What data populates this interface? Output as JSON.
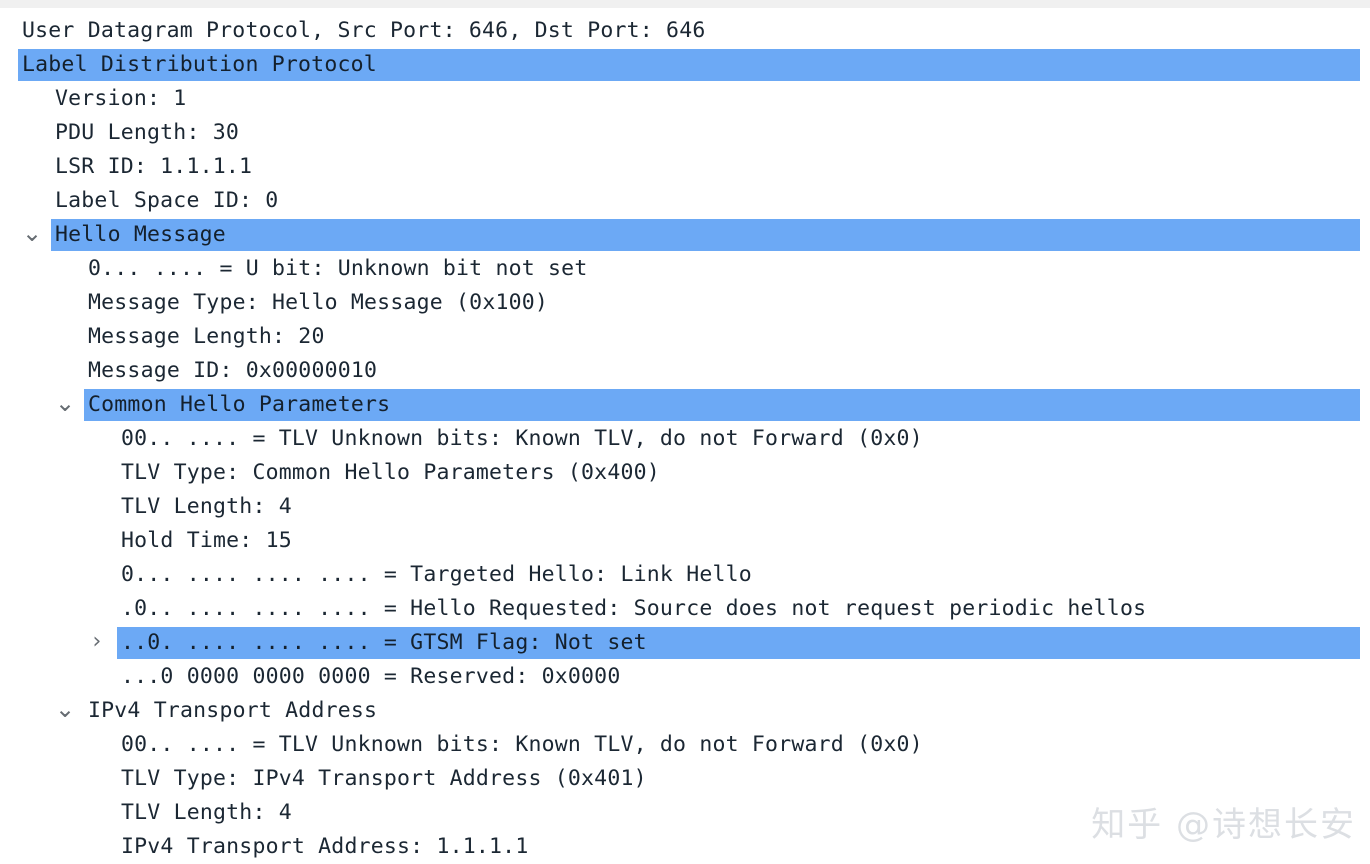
{
  "pane": {
    "name": "packet-details-tree",
    "background_color": "#ffffff",
    "text_color": "#1b2733",
    "selection_color": "#6ca9f5"
  },
  "watermark": {
    "text": "知乎 @诗想长安"
  },
  "rows": [
    {
      "id": "udp-summary",
      "text": "User Datagram Protocol, Src Port: 646, Dst Port: 646",
      "indent": 0,
      "chevron": "none",
      "selected": false
    },
    {
      "id": "ldp-root",
      "text": "Label Distribution Protocol",
      "indent": 0,
      "chevron": "none",
      "selected": true
    },
    {
      "id": "version",
      "text": "Version: 1",
      "indent": 1,
      "chevron": "none",
      "selected": false
    },
    {
      "id": "pdu-length",
      "text": "PDU Length: 30",
      "indent": 1,
      "chevron": "none",
      "selected": false
    },
    {
      "id": "lsr-id",
      "text": "LSR ID: 1.1.1.1",
      "indent": 1,
      "chevron": "none",
      "selected": false
    },
    {
      "id": "label-space-id",
      "text": "Label Space ID: 0",
      "indent": 1,
      "chevron": "none",
      "selected": false
    },
    {
      "id": "hello-message",
      "text": "Hello Message",
      "indent": 1,
      "chevron": "down",
      "selected": true
    },
    {
      "id": "u-bit",
      "text": "0... .... = U bit: Unknown bit not set",
      "indent": 2,
      "chevron": "none",
      "selected": false
    },
    {
      "id": "message-type",
      "text": "Message Type: Hello Message (0x100)",
      "indent": 2,
      "chevron": "none",
      "selected": false
    },
    {
      "id": "message-length",
      "text": "Message Length: 20",
      "indent": 2,
      "chevron": "none",
      "selected": false
    },
    {
      "id": "message-id",
      "text": "Message ID: 0x00000010",
      "indent": 2,
      "chevron": "none",
      "selected": false
    },
    {
      "id": "common-hello-parameters",
      "text": "Common Hello Parameters",
      "indent": 2,
      "chevron": "down",
      "selected": true
    },
    {
      "id": "tlv-unknown-bits-1",
      "text": "00.. .... = TLV Unknown bits: Known TLV, do not Forward (0x0)",
      "indent": 3,
      "chevron": "none",
      "selected": false
    },
    {
      "id": "tlv-type-1",
      "text": "TLV Type: Common Hello Parameters (0x400)",
      "indent": 3,
      "chevron": "none",
      "selected": false
    },
    {
      "id": "tlv-length-1",
      "text": "TLV Length: 4",
      "indent": 3,
      "chevron": "none",
      "selected": false
    },
    {
      "id": "hold-time",
      "text": "Hold Time: 15",
      "indent": 3,
      "chevron": "none",
      "selected": false
    },
    {
      "id": "targeted-hello",
      "text": "0... .... .... .... = Targeted Hello: Link Hello",
      "indent": 3,
      "chevron": "none",
      "selected": false
    },
    {
      "id": "hello-requested",
      "text": ".0.. .... .... .... = Hello Requested: Source does not request periodic hellos",
      "indent": 3,
      "chevron": "none",
      "selected": false
    },
    {
      "id": "gtsm-flag",
      "text": "..0. .... .... .... = GTSM Flag: Not set",
      "indent": 3,
      "chevron": "right",
      "selected": true
    },
    {
      "id": "reserved",
      "text": "...0 0000 0000 0000 = Reserved: 0x0000",
      "indent": 3,
      "chevron": "none",
      "selected": false
    },
    {
      "id": "ipv4-transport-address-group",
      "text": "IPv4 Transport Address",
      "indent": 2,
      "chevron": "down",
      "selected": false
    },
    {
      "id": "tlv-unknown-bits-2",
      "text": "00.. .... = TLV Unknown bits: Known TLV, do not Forward (0x0)",
      "indent": 3,
      "chevron": "none",
      "selected": false
    },
    {
      "id": "tlv-type-2",
      "text": "TLV Type: IPv4 Transport Address (0x401)",
      "indent": 3,
      "chevron": "none",
      "selected": false
    },
    {
      "id": "tlv-length-2",
      "text": "TLV Length: 4",
      "indent": 3,
      "chevron": "none",
      "selected": false
    },
    {
      "id": "ipv4-transport-address-value",
      "text": "IPv4 Transport Address: 1.1.1.1",
      "indent": 3,
      "chevron": "none",
      "selected": false
    }
  ]
}
